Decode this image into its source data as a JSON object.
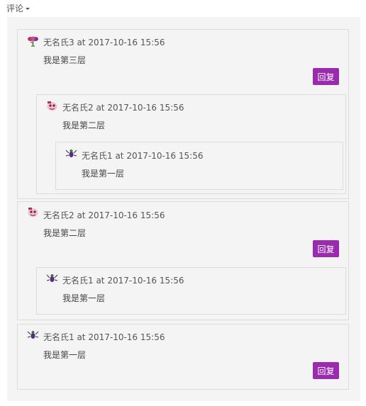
{
  "header": {
    "toggle_label": "评论"
  },
  "reply_label": "回复",
  "comments": {
    "c1": {
      "meta": "无名氏3 at 2017-10-16 15:56",
      "text": "我是第三层",
      "r1": {
        "meta": "无名氏2 at 2017-10-16 15:56",
        "text": "我是第二层",
        "r1": {
          "meta": "无名氏1 at 2017-10-16 15:56",
          "text": "我是第一层"
        }
      }
    },
    "c2": {
      "meta": "无名氏2 at 2017-10-16 15:56",
      "text": "我是第二层",
      "r1": {
        "meta": "无名氏1 at 2017-10-16 15:56",
        "text": "我是第一层"
      }
    },
    "c3": {
      "meta": "无名氏1 at 2017-10-16 15:56",
      "text": "我是第一层"
    }
  },
  "colors": {
    "reply_button": "#9a2aae",
    "panel_bg": "#f4f4f4",
    "border": "#dcdcdc"
  },
  "icons": {
    "avatar_a": "avatar-bouquet-icon",
    "avatar_b": "avatar-cartoon-face-icon",
    "avatar_c": "avatar-spider-icon"
  }
}
